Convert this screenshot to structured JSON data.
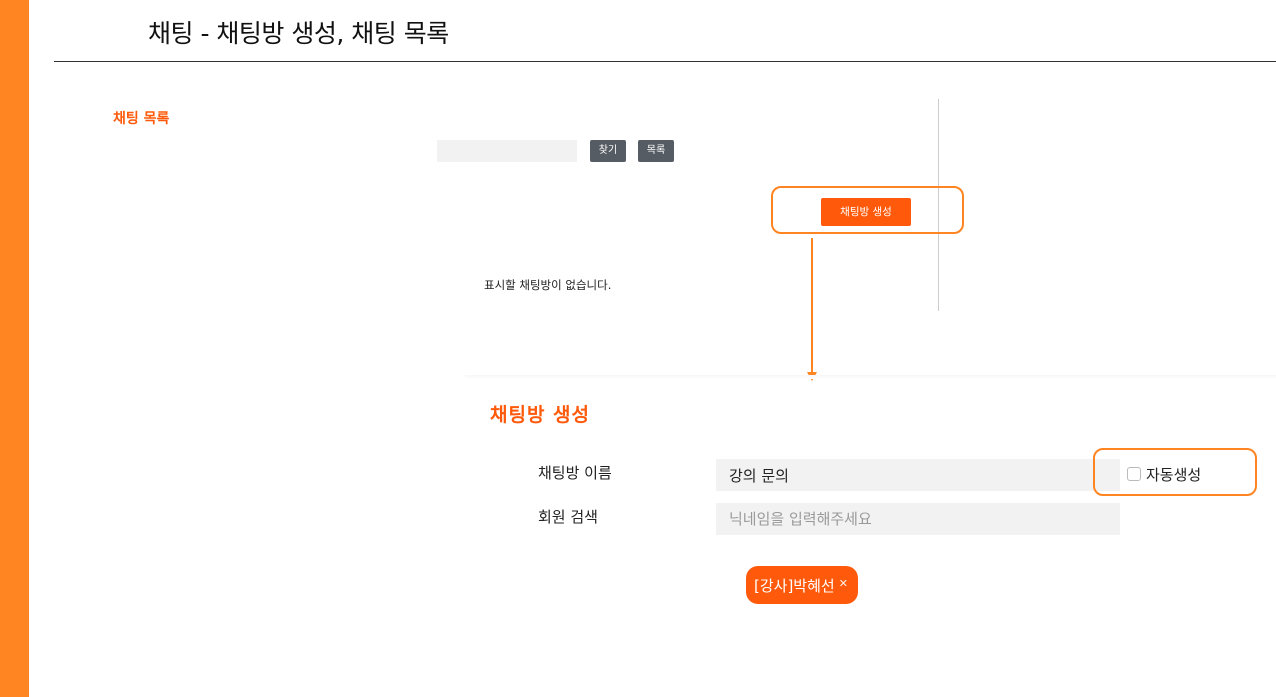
{
  "header": {
    "title": "채팅 - 채팅방 생성, 채팅 목록"
  },
  "sidebar": {
    "title": "채팅 목록"
  },
  "search": {
    "placeholder": "",
    "find_label": "찾기",
    "list_label": "목록"
  },
  "create_button": {
    "label": "채팅방 생성"
  },
  "empty_message": "표시할 채팅방이 없습니다.",
  "create_panel": {
    "title": "채팅방 생성",
    "room_name_label": "채팅방 이름",
    "room_name_value": "강의 문의",
    "member_search_label": "회원 검색",
    "member_search_placeholder": "닉네임을 입력해주세요",
    "auto_create_label": "자동생성",
    "auto_create_checked": false,
    "selected_members": [
      {
        "name": "[강사]박혜선",
        "remove_icon": "close-icon"
      }
    ]
  },
  "colors": {
    "accent": "#FF5A0B",
    "highlight": "#FF8522",
    "sidebar": "#FF8522",
    "button_dark": "#555C63"
  }
}
